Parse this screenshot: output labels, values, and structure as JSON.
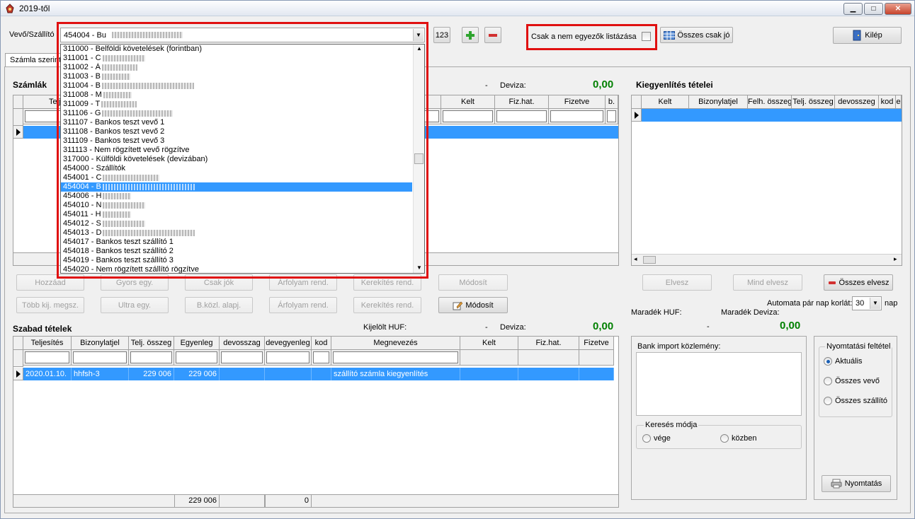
{
  "window": {
    "title": "2019-től",
    "min": "▁",
    "max": "□",
    "close": "✕"
  },
  "top": {
    "vevo_label": "Vevő/Szállító",
    "combo_value": "454004 - Bu",
    "btn_123": "123",
    "only_mismatch_label": "Csak a nem egyezők listázása",
    "all_only_good": "Összes csak jó",
    "exit": "Kilép"
  },
  "tab": {
    "label": "Számla szerint"
  },
  "dropdown": {
    "items": [
      {
        "text": "311000 - Belföldi követelések (forintban)",
        "blur": 0
      },
      {
        "text": "311001 - C",
        "blur": 60
      },
      {
        "text": "311002 - Á",
        "blur": 50
      },
      {
        "text": "311003 - B",
        "blur": 40
      },
      {
        "text": "311004 - B",
        "blur": 130
      },
      {
        "text": "311008 - M",
        "blur": 40
      },
      {
        "text": "311009 - T",
        "blur": 50
      },
      {
        "text": "311106 - G",
        "blur": 100
      },
      {
        "text": "311107 - Bankos teszt vevő 1",
        "blur": 0
      },
      {
        "text": "311108 - Bankos teszt vevő 2",
        "blur": 0
      },
      {
        "text": "311109 - Bankos teszt vevő 3",
        "blur": 0
      },
      {
        "text": "311113 - Nem rögzített vevő rögzítve",
        "blur": 0
      },
      {
        "text": "317000 - Külföldi követelések (devizában)",
        "blur": 0
      },
      {
        "text": "454000 - Szállítók",
        "blur": 0
      },
      {
        "text": "454001 - C",
        "blur": 80
      },
      {
        "text": "454004 - B",
        "blur": 130,
        "selected": true
      },
      {
        "text": "454006 - H",
        "blur": 40
      },
      {
        "text": "454010 - N",
        "blur": 60
      },
      {
        "text": "454011 - H",
        "blur": 40
      },
      {
        "text": "454012 - S",
        "blur": 60
      },
      {
        "text": "454013 - D",
        "blur": 130
      },
      {
        "text": "454017 - Bankos teszt szállító 1",
        "blur": 0
      },
      {
        "text": "454018 - Bankos teszt szállító 2",
        "blur": 0
      },
      {
        "text": "454019 - Bankos teszt szállító 3",
        "blur": 0
      },
      {
        "text": "454020 - Nem rögzített szállító rögzítve",
        "blur": 0
      }
    ]
  },
  "szamlak": {
    "title": "Számlák",
    "dash": "-",
    "deviza_label": "Deviza:",
    "deviza_value": "0,00",
    "headers": [
      "Telje",
      "Kelt",
      "Fiz.hat.",
      "Fizetve",
      "b."
    ]
  },
  "kiegyenlites": {
    "title": "Kiegyenlítés tételei",
    "headers": [
      "Kelt",
      "Bizonylatjel",
      "Felh. összeg",
      "Telj. összeg",
      "devosszeg",
      "kod",
      "e"
    ],
    "btn_elvesz": "Elvesz",
    "btn_mind_elvesz": "Mind elvesz",
    "btn_osszes_elvesz": "Összes elvesz"
  },
  "buttons_row1": [
    "Hozzáad",
    "Gyors egy.",
    "Csak jók",
    "Árfolyam rend.",
    "Kerekítés rend.",
    "Módosít"
  ],
  "buttons_row2": [
    "Több kij. megsz.",
    "Ultra egy.",
    "B.közl. alapj.",
    "Árfolyam rend.",
    "Kerekítés rend.",
    "Módosít"
  ],
  "automata": {
    "label": "Automata pár nap korlát:",
    "value": "30",
    "unit": "nap"
  },
  "maradek": {
    "huf_label": "Maradék HUF:",
    "deviza_label": "Maradék Deviza:",
    "huf_value": "-",
    "deviza_value": "0,00"
  },
  "szabad": {
    "title": "Szabad tételek",
    "kijelolt_label": "Kijelölt HUF:",
    "kijelolt_value": "-",
    "deviza_label": "Deviza:",
    "deviza_value": "0,00",
    "headers": [
      "Teljesítés",
      "Bizonylatjel",
      "Telj. összeg",
      "Egyenleg",
      "devosszag",
      "devegyenleg",
      "kod",
      "Megnevezés",
      "Kelt",
      "Fiz.hat.",
      "Fizetve"
    ],
    "row": [
      "2020.01.10.",
      "hhfsh-3",
      "229 006",
      "229 006",
      "",
      "",
      "",
      "szállító számla kiegyenlítés",
      "",
      "",
      ""
    ],
    "footer_telj": "229 006",
    "footer_dev": "0"
  },
  "bank": {
    "label": "Bank import közlemény:",
    "search_title": "Keresés módja",
    "opt_vege": "vége",
    "opt_kozben": "közben"
  },
  "print": {
    "title": "Nyomtatási feltétel",
    "opts": [
      "Aktuális",
      "Összes vevő",
      "Összes szállító"
    ],
    "button": "Nyomtatás"
  },
  "accent": {
    "selection": "#3399ff",
    "green": "#008000",
    "highlight": "#e01010"
  }
}
